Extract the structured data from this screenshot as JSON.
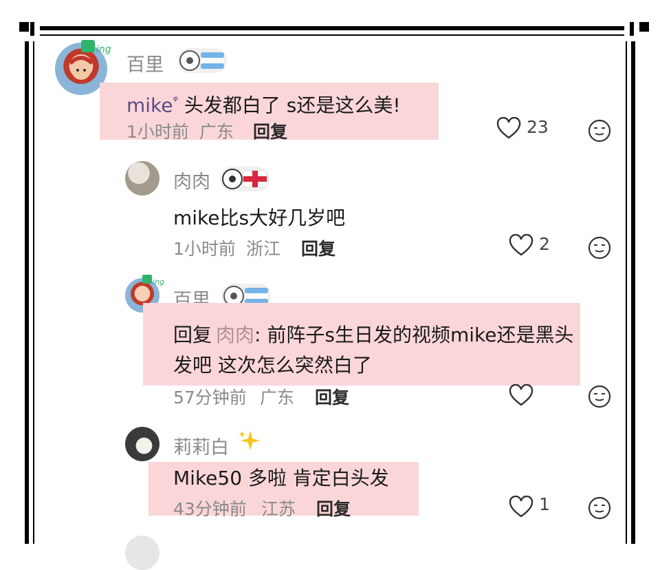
{
  "comments": [
    {
      "user": "百里",
      "mention": "mike",
      "mention_mark": "ᵠ",
      "text": " 头发都白了 s还是这么美!",
      "time": "1小时前",
      "region": "广东",
      "reply_label": "回复",
      "likes": "23",
      "badge_icon": "soccer-ball-argentina-flag-icon"
    },
    {
      "user": "肉肉",
      "text": "mike比s大好几岁吧",
      "time": "1小时前",
      "region": "浙江",
      "reply_label": "回复",
      "likes": "2",
      "badge_icon": "soccer-ball-england-flag-icon"
    },
    {
      "user": "百里",
      "reply_prefix": "回复",
      "reply_to": "肉肉",
      "text_line1": ": 前阵子s生日发的视频mike还是黑头",
      "text_line2": "发吧 这次怎么突然白了",
      "time": "57分钟前",
      "region": "广东",
      "reply_label": "回复",
      "likes": "",
      "badge_icon": "soccer-ball-argentina-flag-icon"
    },
    {
      "user": "莉莉白",
      "text": "Mike50 多啦 肯定白头发",
      "time": "43分钟前",
      "region": "江苏",
      "reply_label": "回复",
      "likes": "1",
      "badge_icon": "sparkles-icon"
    }
  ],
  "colors": {
    "highlight": "#fbd6d9",
    "username": "#8a8a8a",
    "mention": "#5a4c88"
  }
}
